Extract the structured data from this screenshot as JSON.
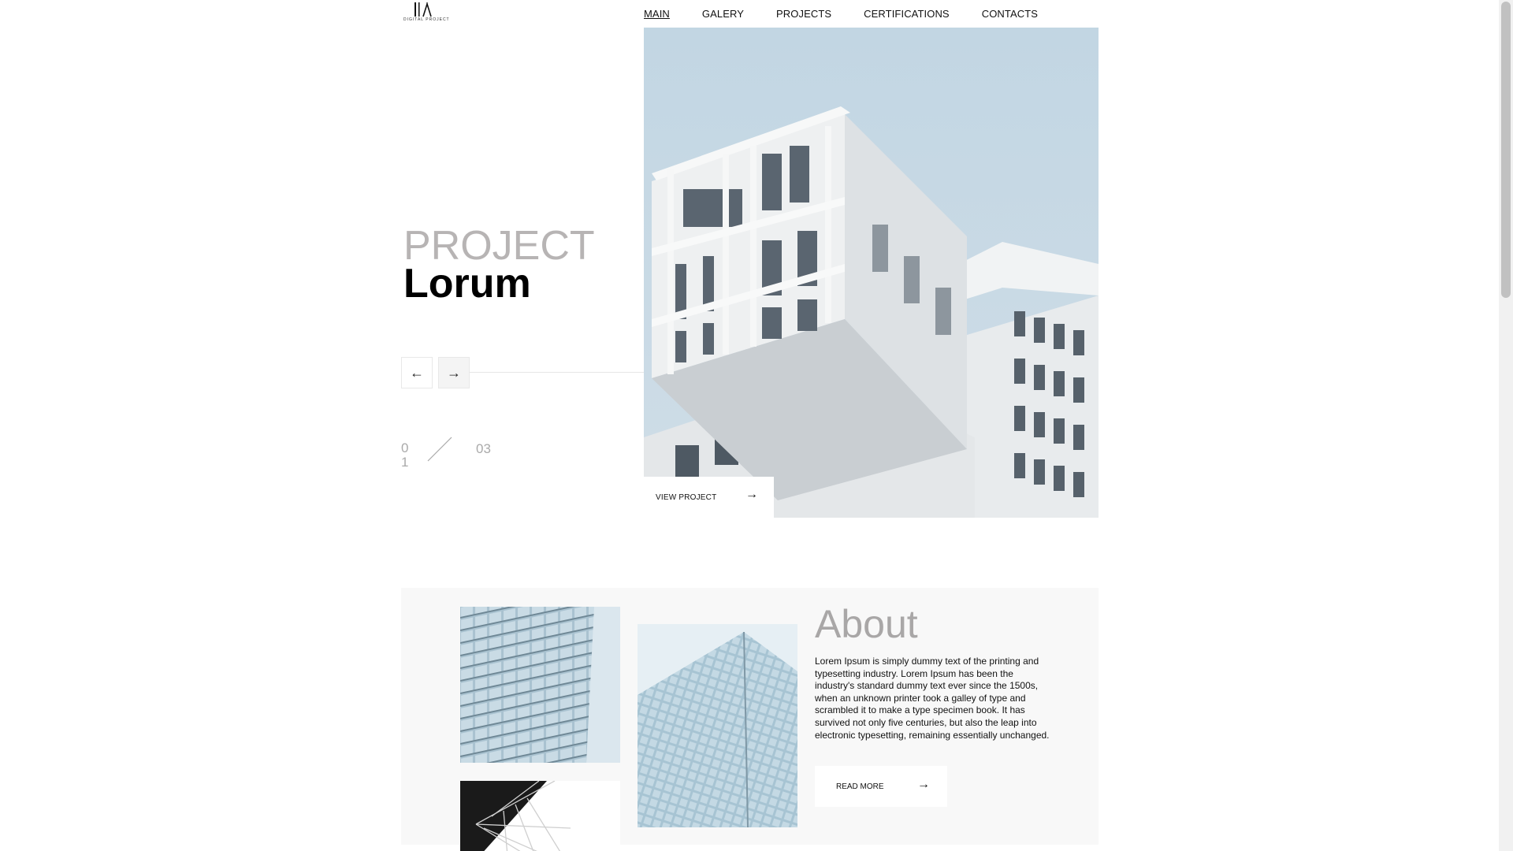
{
  "logo": {
    "text": "DIGITAL PROJECT"
  },
  "nav": {
    "items": [
      {
        "label": "MAIN",
        "active": true
      },
      {
        "label": "GALERY",
        "active": false
      },
      {
        "label": "PROJECTS",
        "active": false
      },
      {
        "label": "CERTIFICATIONS",
        "active": false
      },
      {
        "label": "CONTACTS",
        "active": false
      }
    ]
  },
  "hero": {
    "title_light": "PROJECT",
    "title_bold": "Lorum",
    "prev_icon": "←",
    "next_icon": "→",
    "counter_current": "01",
    "counter_total": "03",
    "view_project_label": "VIEW PROJECT",
    "view_project_icon": "→"
  },
  "about": {
    "title": "About",
    "text": "Lorem Ipsum is simply dummy text of the printing and typesetting industry. Lorem Ipsum has been the industry's standard dummy text ever since the 1500s, when an unknown printer took a galley of type and scrambled it to make a type specimen book. It has survived not only five centuries, but also the leap into electronic typesetting, remaining essentially unchanged.",
    "read_more_label": "READ MORE",
    "read_more_icon": "→"
  },
  "colors": {
    "sky": "#c5d8e4",
    "building": "#e9ecee",
    "title_grey": "#b7b4b4",
    "panel_bg": "#f8f8f8"
  }
}
